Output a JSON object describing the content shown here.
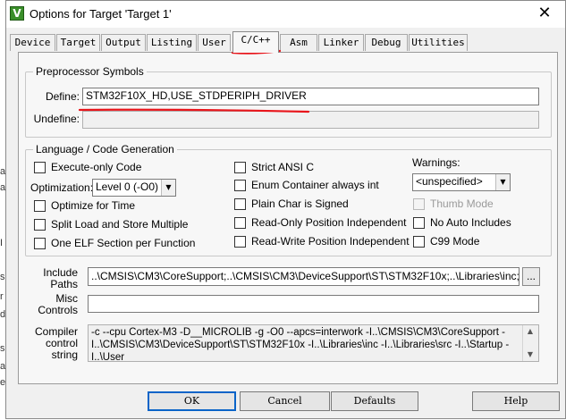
{
  "left_strip": [
    "a",
    "a",
    "I",
    "s",
    "r",
    "d",
    "s",
    "a",
    "e"
  ],
  "window": {
    "title": "Options for Target 'Target 1'",
    "app_icon": "V",
    "close_glyph": "✕"
  },
  "tabs": [
    {
      "label": "Device"
    },
    {
      "label": "Target"
    },
    {
      "label": "Output"
    },
    {
      "label": "Listing"
    },
    {
      "label": "User"
    },
    {
      "label": "C/C++",
      "active": true
    },
    {
      "label": "Asm"
    },
    {
      "label": "Linker"
    },
    {
      "label": "Debug"
    },
    {
      "label": "Utilities"
    }
  ],
  "preprocessor": {
    "legend": "Preprocessor Symbols",
    "define_label": "Define:",
    "define_value": "STM32F10X_HD,USE_STDPERIPH_DRIVER",
    "undefine_label": "Undefine:",
    "undefine_value": ""
  },
  "language": {
    "legend": "Language / Code Generation",
    "execute_only": "Execute-only Code",
    "optimization_label": "Optimization:",
    "optimization_value": "Level 0 (-O0)",
    "optimize_time": "Optimize for Time",
    "split_load_store": "Split Load and Store Multiple",
    "one_elf": "One ELF Section per Function",
    "strict_ansi": "Strict ANSI C",
    "enum_container": "Enum Container always int",
    "plain_char": "Plain Char is Signed",
    "ro_pos_indep": "Read-Only Position Independent",
    "rw_pos_indep": "Read-Write Position Independent",
    "warnings_label": "Warnings:",
    "warnings_value": "<unspecified>",
    "thumb_mode": "Thumb Mode",
    "no_auto_includes": "No Auto Includes",
    "c99_mode": "C99 Mode"
  },
  "paths": {
    "include_label_1": "Include",
    "include_label_2": "Paths",
    "include_value": "..\\CMSIS\\CM3\\CoreSupport;..\\CMSIS\\CM3\\DeviceSupport\\ST\\STM32F10x;..\\Libraries\\inc;..\\Libraries\\src;..\\Startup;..\\User",
    "browse_label": "...",
    "misc_label_1": "Misc",
    "misc_label_2": "Controls",
    "misc_value": "",
    "compiler_label_1": "Compiler",
    "compiler_label_2": "control",
    "compiler_label_3": "string",
    "compiler_value": "-c --cpu Cortex-M3 -D__MICROLIB -g -O0 --apcs=interwork -I..\\CMSIS\\CM3\\CoreSupport -I..\\CMSIS\\CM3\\DeviceSupport\\ST\\STM32F10x -I..\\Libraries\\inc -I..\\Libraries\\src -I..\\Startup -I..\\User"
  },
  "buttons": {
    "ok": "OK",
    "cancel": "Cancel",
    "defaults": "Defaults",
    "help": "Help"
  },
  "icons": {
    "dropdown_arrow": "▼",
    "scroll_up": "▲",
    "scroll_down": "▼"
  },
  "colors": {
    "annotation_red": "#e8151b",
    "focus_blue": "#0a64c8"
  }
}
